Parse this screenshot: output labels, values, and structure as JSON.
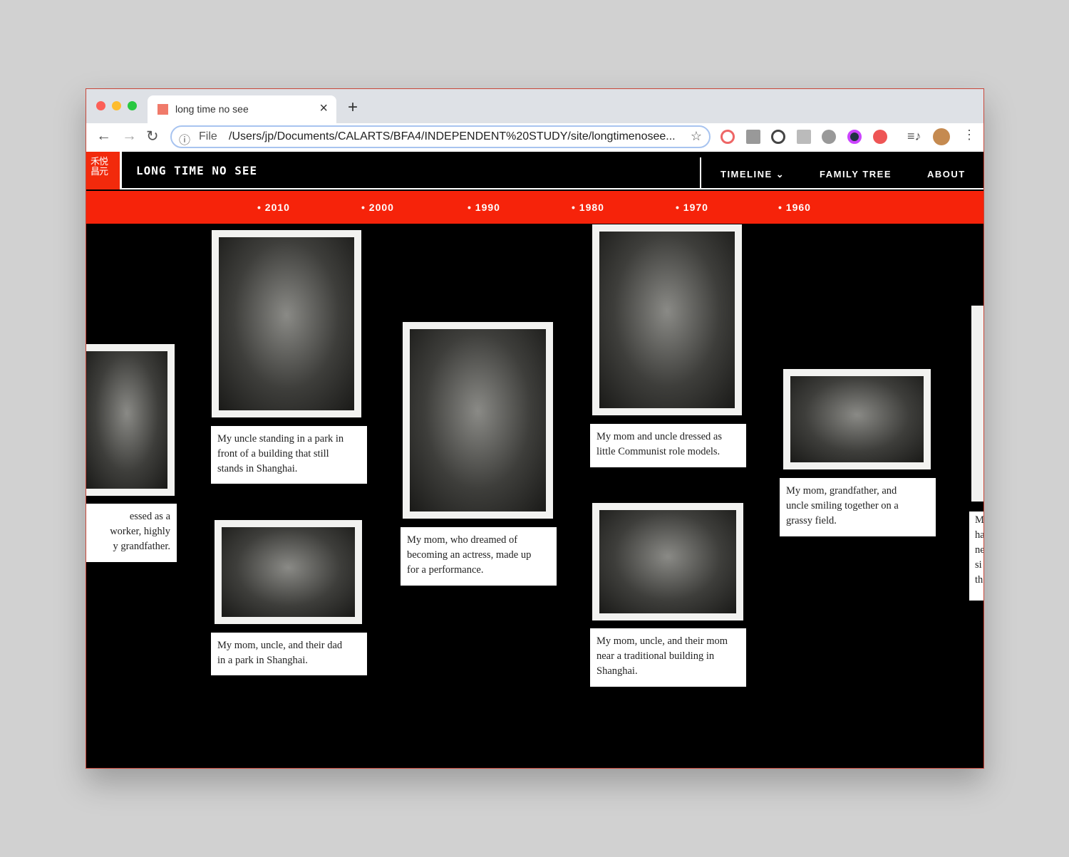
{
  "browser": {
    "tab_title": "long time no see",
    "url_prefix": "File",
    "url": "/Users/jp/Documents/CALARTS/BFA4/INDEPENDENT%20STUDY/site/longtimenosee..."
  },
  "site": {
    "logo_glyphs": "禾悦 昌元",
    "title": "LONG TIME NO SEE",
    "menu": [
      {
        "label": "TIMELINE ⌄"
      },
      {
        "label": "FAMILY TREE"
      },
      {
        "label": "ABOUT"
      }
    ],
    "years": [
      "• 2010",
      "• 2000",
      "• 1990",
      "• 1980",
      "• 1970",
      "• 1960"
    ]
  },
  "captions": {
    "c0": [
      "essed as a",
      "worker, highly",
      "y grandfather."
    ],
    "c1": [
      "My uncle standing in a park in",
      "front of a building that still",
      "stands in Shanghai."
    ],
    "c2": [
      "My mom, uncle, and their dad",
      "in a park in Shanghai."
    ],
    "c3": [
      "My mom, who dreamed of",
      "becoming an actress, made up",
      "for a performance."
    ],
    "c4": [
      "My mom and uncle dressed as",
      "little Communist role models."
    ],
    "c5": [
      "My mom, uncle, and their mom",
      "near a traditional building in",
      "Shanghai."
    ],
    "c6": [
      "My mom, grandfather, and",
      "uncle smiling together on a",
      "grassy field."
    ],
    "c7": [
      "M",
      "ha",
      "ne",
      "si",
      "th"
    ]
  }
}
